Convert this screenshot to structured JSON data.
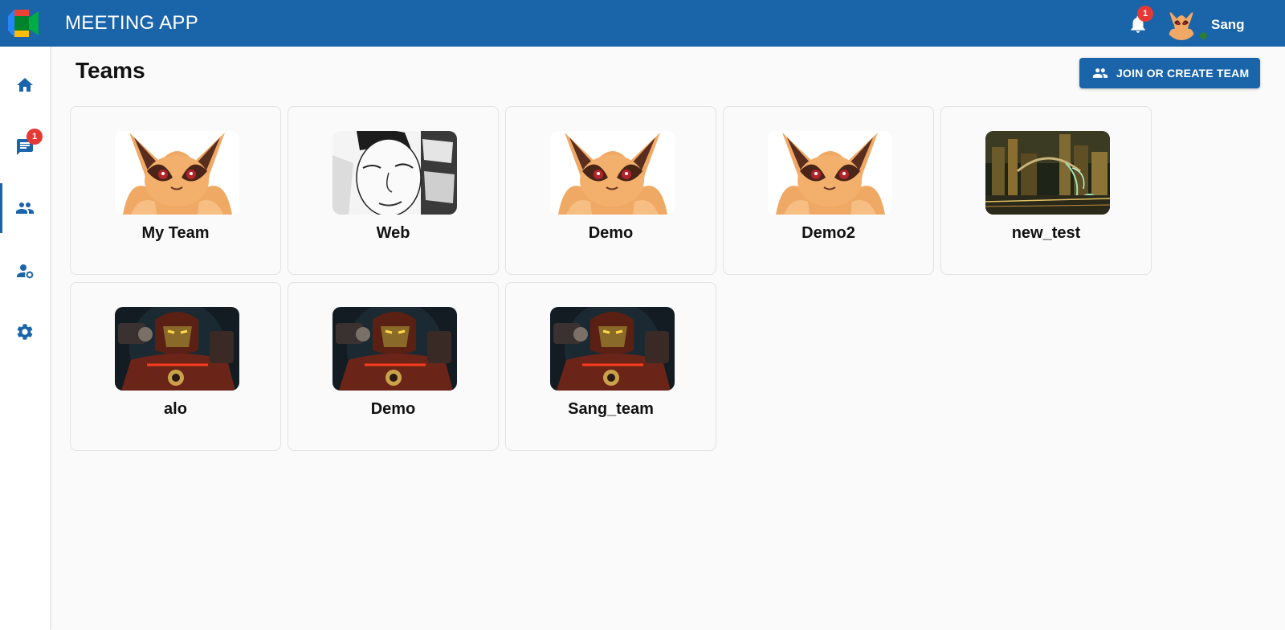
{
  "header": {
    "title": "MEETING APP",
    "notification_count": "1",
    "user_name": "Sang",
    "logo_icon": "meet-logo-icon",
    "brand_color": "#1a64aa"
  },
  "sidebar": {
    "items": [
      {
        "name": "home",
        "icon": "home-icon",
        "active": false
      },
      {
        "name": "chat",
        "icon": "chat-icon",
        "active": false,
        "badge": "1"
      },
      {
        "name": "teams",
        "icon": "people-icon",
        "active": true
      },
      {
        "name": "account",
        "icon": "user-gear-icon",
        "active": false
      },
      {
        "name": "settings",
        "icon": "gear-icon",
        "active": false
      }
    ]
  },
  "main": {
    "title": "Teams",
    "join_button": "JOIN OR CREATE TEAM",
    "teams": [
      {
        "name": "My Team",
        "image": "fox"
      },
      {
        "name": "Web",
        "image": "sketch"
      },
      {
        "name": "Demo",
        "image": "fox"
      },
      {
        "name": "Demo2",
        "image": "fox"
      },
      {
        "name": "new_test",
        "image": "city"
      },
      {
        "name": "alo",
        "image": "robot"
      },
      {
        "name": "Demo",
        "image": "robot"
      },
      {
        "name": "Sang_team",
        "image": "robot"
      }
    ]
  }
}
